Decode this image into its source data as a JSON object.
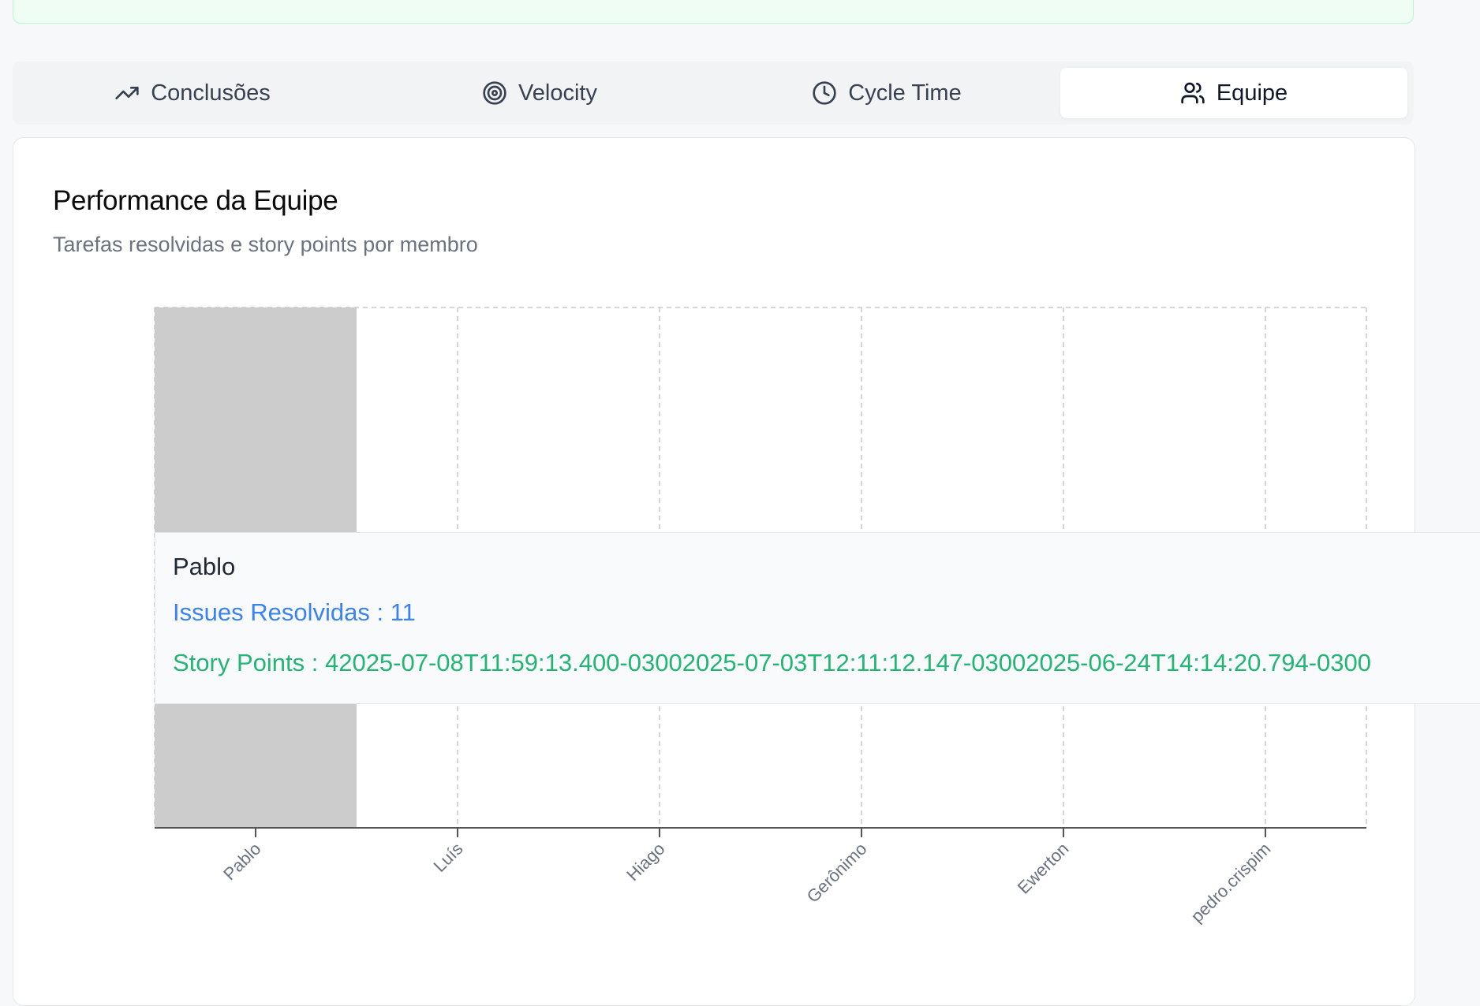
{
  "tabs": [
    {
      "label": "Conclusões",
      "icon": "trending-up-icon",
      "active": false
    },
    {
      "label": "Velocity",
      "icon": "target-icon",
      "active": false
    },
    {
      "label": "Cycle Time",
      "icon": "clock-icon",
      "active": false
    },
    {
      "label": "Equipe",
      "icon": "users-icon",
      "active": true
    }
  ],
  "card": {
    "title": "Performance da Equipe",
    "subtitle": "Tarefas resolvidas e story points por membro"
  },
  "chart_data": {
    "type": "bar",
    "categories": [
      "Pablo",
      "Luís",
      "Hiago",
      "Gerônimo",
      "Ewerton",
      "pedro.crispim"
    ],
    "series": [
      {
        "name": "Issues Resolvidas",
        "values": [
          11,
          null,
          null,
          null,
          null,
          null
        ]
      }
    ],
    "highlighted_category": "Pablo",
    "grid": true,
    "colors": {
      "hover": "#cccccc",
      "grid": "#c8c8c8",
      "axis": "#555555"
    }
  },
  "tooltip": {
    "label": "Pablo",
    "issues_name": "Issues Resolvidas",
    "issues_value": "11",
    "points_name": "Story Points",
    "points_value": "42025-07-08T11:59:13.400-03002025-07-03T12:11:12.147-03002025-06-24T14:14:20.794-0300",
    "separator": " : "
  },
  "colors": {
    "issues": "#3b82f6",
    "points": "#22b573"
  }
}
